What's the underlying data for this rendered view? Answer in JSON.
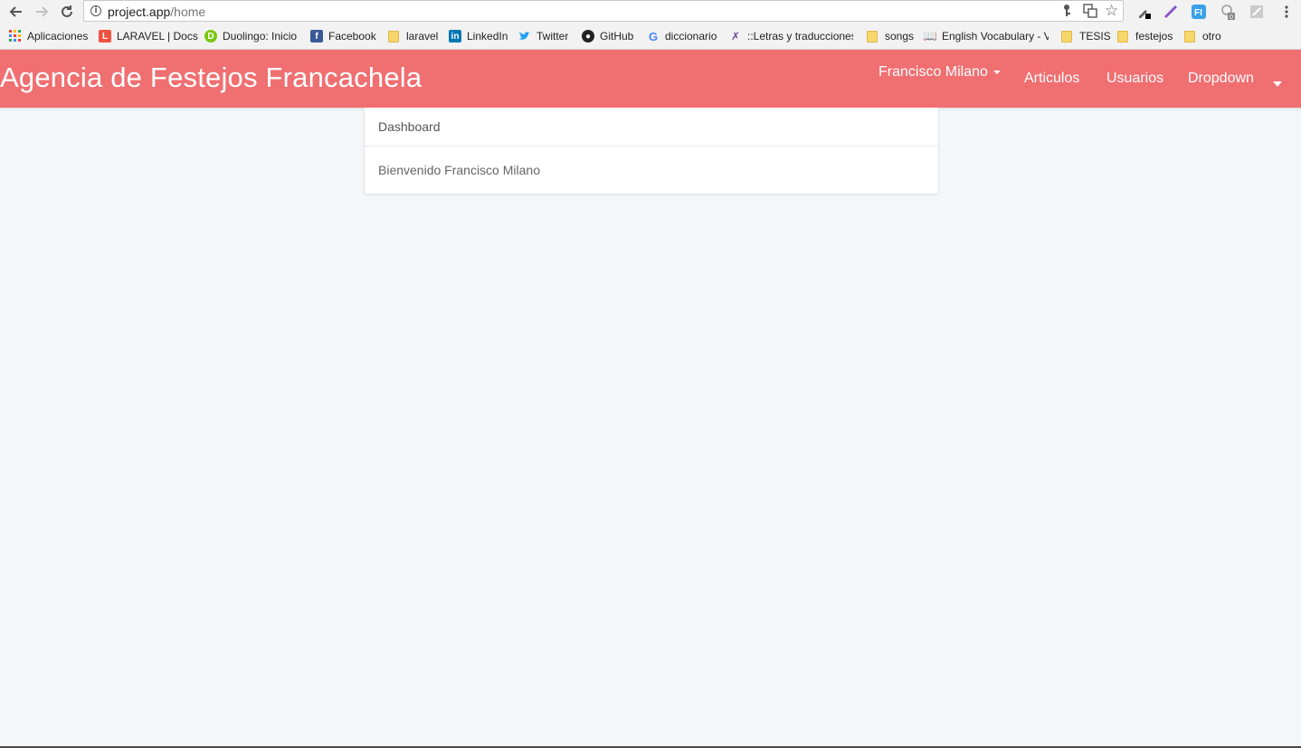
{
  "browser": {
    "url_host": "project.app",
    "url_path": "/home",
    "bookmarks": [
      {
        "label": "Aplicaciones",
        "icon": "apps-grid-icon"
      },
      {
        "label": "LARAVEL | Docs",
        "icon": "laravel-icon"
      },
      {
        "label": "Duolingo: Inicio",
        "icon": "duolingo-icon"
      },
      {
        "label": "Facebook",
        "icon": "facebook-icon"
      },
      {
        "label": "laravel",
        "icon": "folder-icon"
      },
      {
        "label": "LinkedIn",
        "icon": "linkedin-icon"
      },
      {
        "label": "Twitter",
        "icon": "twitter-icon"
      },
      {
        "label": "GitHub",
        "icon": "github-icon"
      },
      {
        "label": "diccionario",
        "icon": "google-icon"
      },
      {
        "label": "::Letras y traducciones",
        "icon": "letras-icon"
      },
      {
        "label": "songs",
        "icon": "folder-icon"
      },
      {
        "label": "English Vocabulary - V",
        "icon": "vocabulary-icon"
      },
      {
        "label": "TESIS",
        "icon": "folder-icon"
      },
      {
        "label": "festejos",
        "icon": "folder-icon"
      },
      {
        "label": "otro",
        "icon": "folder-icon"
      }
    ]
  },
  "navbar": {
    "brand": "Agencia de Festejos Francachela",
    "user_menu": "Francisco Milano",
    "links": {
      "articulos": "Articulos",
      "usuarios": "Usuarios",
      "dropdown": "Dropdown"
    }
  },
  "panel": {
    "heading": "Dashboard",
    "body": "Bienvenido Francisco Milano"
  },
  "colors": {
    "navbar_bg": "#f06f71",
    "page_bg": "#f4f7fa"
  }
}
